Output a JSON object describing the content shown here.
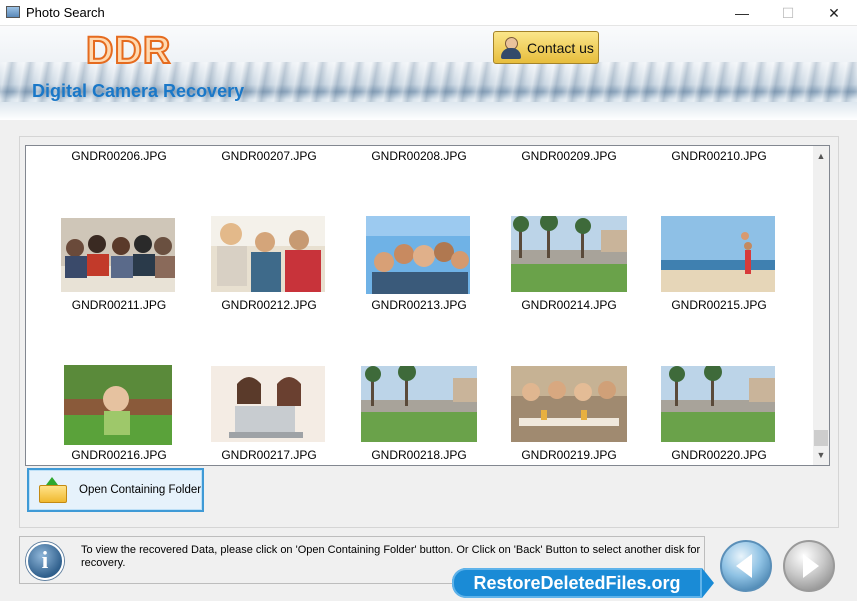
{
  "window": {
    "title": "Photo Search",
    "minimize": "—",
    "maximize": "☐",
    "close": "✕"
  },
  "header": {
    "logo": "DDR",
    "subtitle": "Digital Camera Recovery",
    "contact_label": "Contact us"
  },
  "files": {
    "row0": [
      "GNDR00206.JPG",
      "GNDR00207.JPG",
      "GNDR00208.JPG",
      "GNDR00209.JPG",
      "GNDR00210.JPG"
    ],
    "row1": [
      "GNDR00211.JPG",
      "GNDR00212.JPG",
      "GNDR00213.JPG",
      "GNDR00214.JPG",
      "GNDR00215.JPG"
    ],
    "row2": [
      "GNDR00216.JPG",
      "GNDR00217.JPG",
      "GNDR00218.JPG",
      "GNDR00219.JPG",
      "GNDR00220.JPG"
    ]
  },
  "scroll": {
    "up": "▲",
    "down": "▼"
  },
  "actions": {
    "open_folder_label": "Open Containing Folder"
  },
  "info": {
    "icon": "i",
    "text": "To view the recovered Data, please click on 'Open Containing Folder' button. Or Click on 'Back' Button to select another disk for recovery."
  },
  "watermark": "RestoreDeletedFiles.org"
}
